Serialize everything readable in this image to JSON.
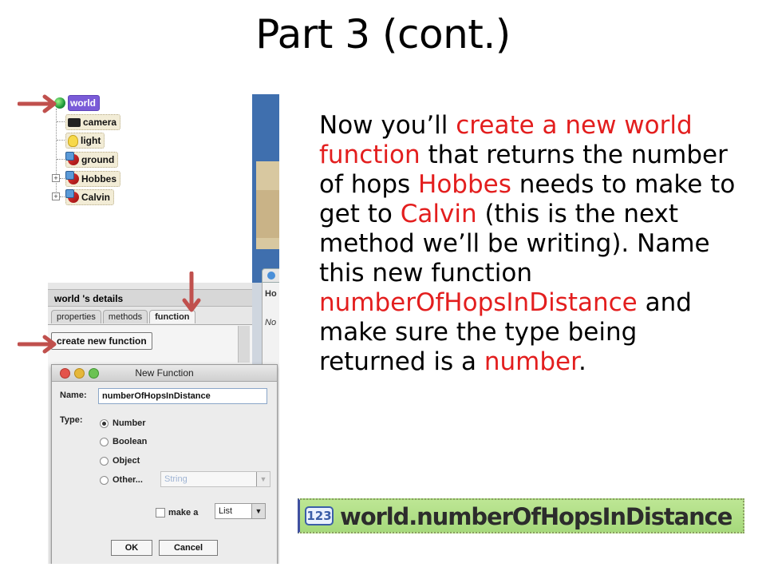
{
  "slide": {
    "title": "Part 3 (cont.)",
    "body_segments": [
      {
        "text": "Now you’ll ",
        "color": "black"
      },
      {
        "text": "create a new world function",
        "color": "red"
      },
      {
        "text": " that returns the number of hops ",
        "color": "black"
      },
      {
        "text": "Hobbes",
        "color": "red"
      },
      {
        "text": " needs to make to get to ",
        "color": "black"
      },
      {
        "text": "Calvin",
        "color": "red"
      },
      {
        "text": " (this is the next method we’ll be writing). Name this new function ",
        "color": "black"
      },
      {
        "text": "numberOfHopsInDistance",
        "color": "red"
      },
      {
        "text": " and make sure the type being returned is a ",
        "color": "black"
      },
      {
        "text": "number",
        "color": "red"
      },
      {
        "text": ".",
        "color": "black"
      }
    ],
    "accent_red": "#e31e1e"
  },
  "object_tree": {
    "root": {
      "label": "world",
      "icon": "globe-icon"
    },
    "children": [
      {
        "label": "camera",
        "icon": "camera-icon"
      },
      {
        "label": "light",
        "icon": "lightbulb-icon"
      },
      {
        "label": "ground",
        "icon": "object-icon"
      },
      {
        "label": "Hobbes",
        "icon": "object-icon",
        "expandable": true
      },
      {
        "label": "Calvin",
        "icon": "object-icon",
        "expandable": true
      }
    ]
  },
  "details": {
    "header": "world 's details",
    "tabs": [
      "properties",
      "methods",
      "function"
    ],
    "create_button": "create new function",
    "sliver_labels": [
      "Ho",
      "No"
    ]
  },
  "dialog": {
    "title": "New Function",
    "name_label": "Name:",
    "name_value": "numberOfHopsInDistance",
    "type_label": "Type:",
    "type_options": [
      "Number",
      "Boolean",
      "Object",
      "Other..."
    ],
    "selected_type": "Number",
    "other_combo_value": "String",
    "make_a_label": "make a",
    "make_a_combo_value": "List",
    "ok_label": "OK",
    "cancel_label": "Cancel"
  },
  "function_tile": {
    "badge": "123",
    "name": "world.numberOfHopsInDistance"
  },
  "colors": {
    "annotation_arrow": "#c0504d",
    "tile_green": "#a6d97c",
    "world_purple": "#7a5bd8"
  }
}
